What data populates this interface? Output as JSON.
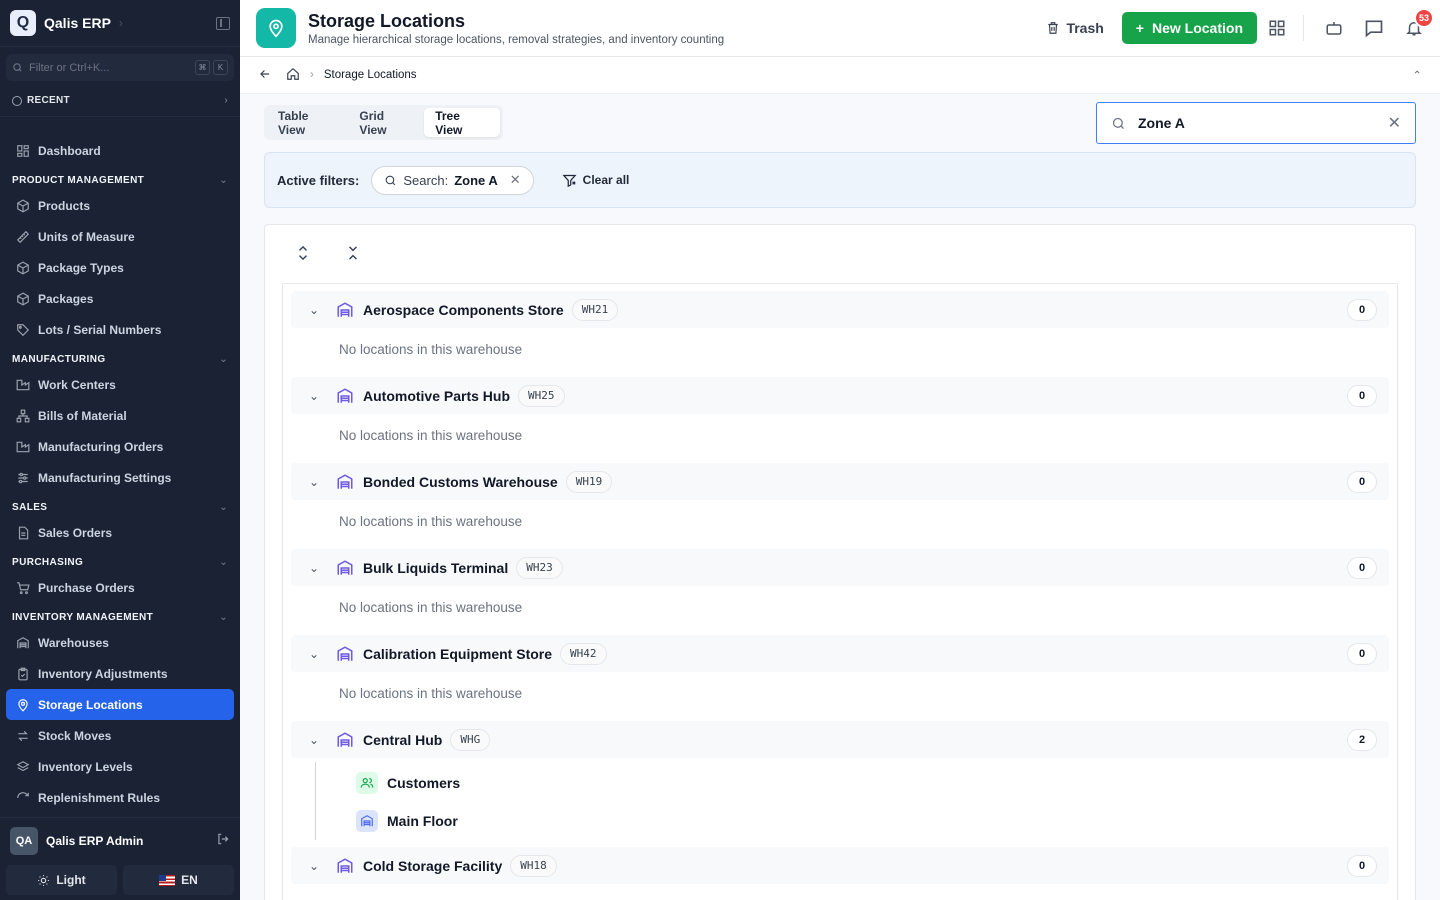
{
  "app": {
    "logo_letter": "Q",
    "name": "Qalis ERP"
  },
  "sidebar": {
    "search_placeholder": "Filter or Ctrl+K...",
    "kbd": [
      "⌘",
      "K"
    ],
    "recent_label": "RECENT",
    "dashboard": "Dashboard",
    "sections": [
      {
        "title": "PRODUCT MANAGEMENT",
        "items": [
          "Products",
          "Units of Measure",
          "Package Types",
          "Packages",
          "Lots / Serial Numbers"
        ]
      },
      {
        "title": "MANUFACTURING",
        "items": [
          "Work Centers",
          "Bills of Material",
          "Manufacturing Orders",
          "Manufacturing Settings"
        ]
      },
      {
        "title": "SALES",
        "items": [
          "Sales Orders"
        ]
      },
      {
        "title": "PURCHASING",
        "items": [
          "Purchase Orders"
        ]
      },
      {
        "title": "INVENTORY MANAGEMENT",
        "items": [
          "Warehouses",
          "Inventory Adjustments",
          "Storage Locations",
          "Stock Moves",
          "Inventory Levels",
          "Replenishment Rules"
        ]
      }
    ],
    "active_item": "Storage Locations",
    "user": {
      "initials": "QA",
      "name": "Qalis ERP Admin"
    },
    "theme_label": "Light",
    "lang_label": "EN"
  },
  "header": {
    "title": "Storage Locations",
    "subtitle": "Manage hierarchical storage locations, removal strategies, and inventory counting",
    "trash_label": "Trash",
    "new_label": "New Location",
    "notification_count": "53",
    "accent": "#14b8a6",
    "primary": "#16a34a"
  },
  "breadcrumb": {
    "current": "Storage Locations"
  },
  "view_tabs": [
    "Table View",
    "Grid View",
    "Tree View"
  ],
  "active_tab": "Tree View",
  "search": {
    "value": "Zone A"
  },
  "filters": {
    "label": "Active filters:",
    "chip_key": "Search:",
    "chip_value": "Zone A",
    "clear_label": "Clear all"
  },
  "tree": {
    "empty_text": "No locations in this warehouse",
    "warehouses": [
      {
        "name": "Aerospace Components Store",
        "code": "WH21",
        "count": "0",
        "children": []
      },
      {
        "name": "Automotive Parts Hub",
        "code": "WH25",
        "count": "0",
        "children": []
      },
      {
        "name": "Bonded Customs Warehouse",
        "code": "WH19",
        "count": "0",
        "children": []
      },
      {
        "name": "Bulk Liquids Terminal",
        "code": "WH23",
        "count": "0",
        "children": []
      },
      {
        "name": "Calibration Equipment Store",
        "code": "WH42",
        "count": "0",
        "children": []
      },
      {
        "name": "Central Hub",
        "code": "WHG",
        "count": "2",
        "children": [
          {
            "name": "Customers",
            "icon": "users-icon"
          },
          {
            "name": "Main Floor",
            "icon": "warehouse-icon"
          }
        ]
      },
      {
        "name": "Cold Storage Facility",
        "code": "WH18",
        "count": "0",
        "children": []
      }
    ]
  }
}
